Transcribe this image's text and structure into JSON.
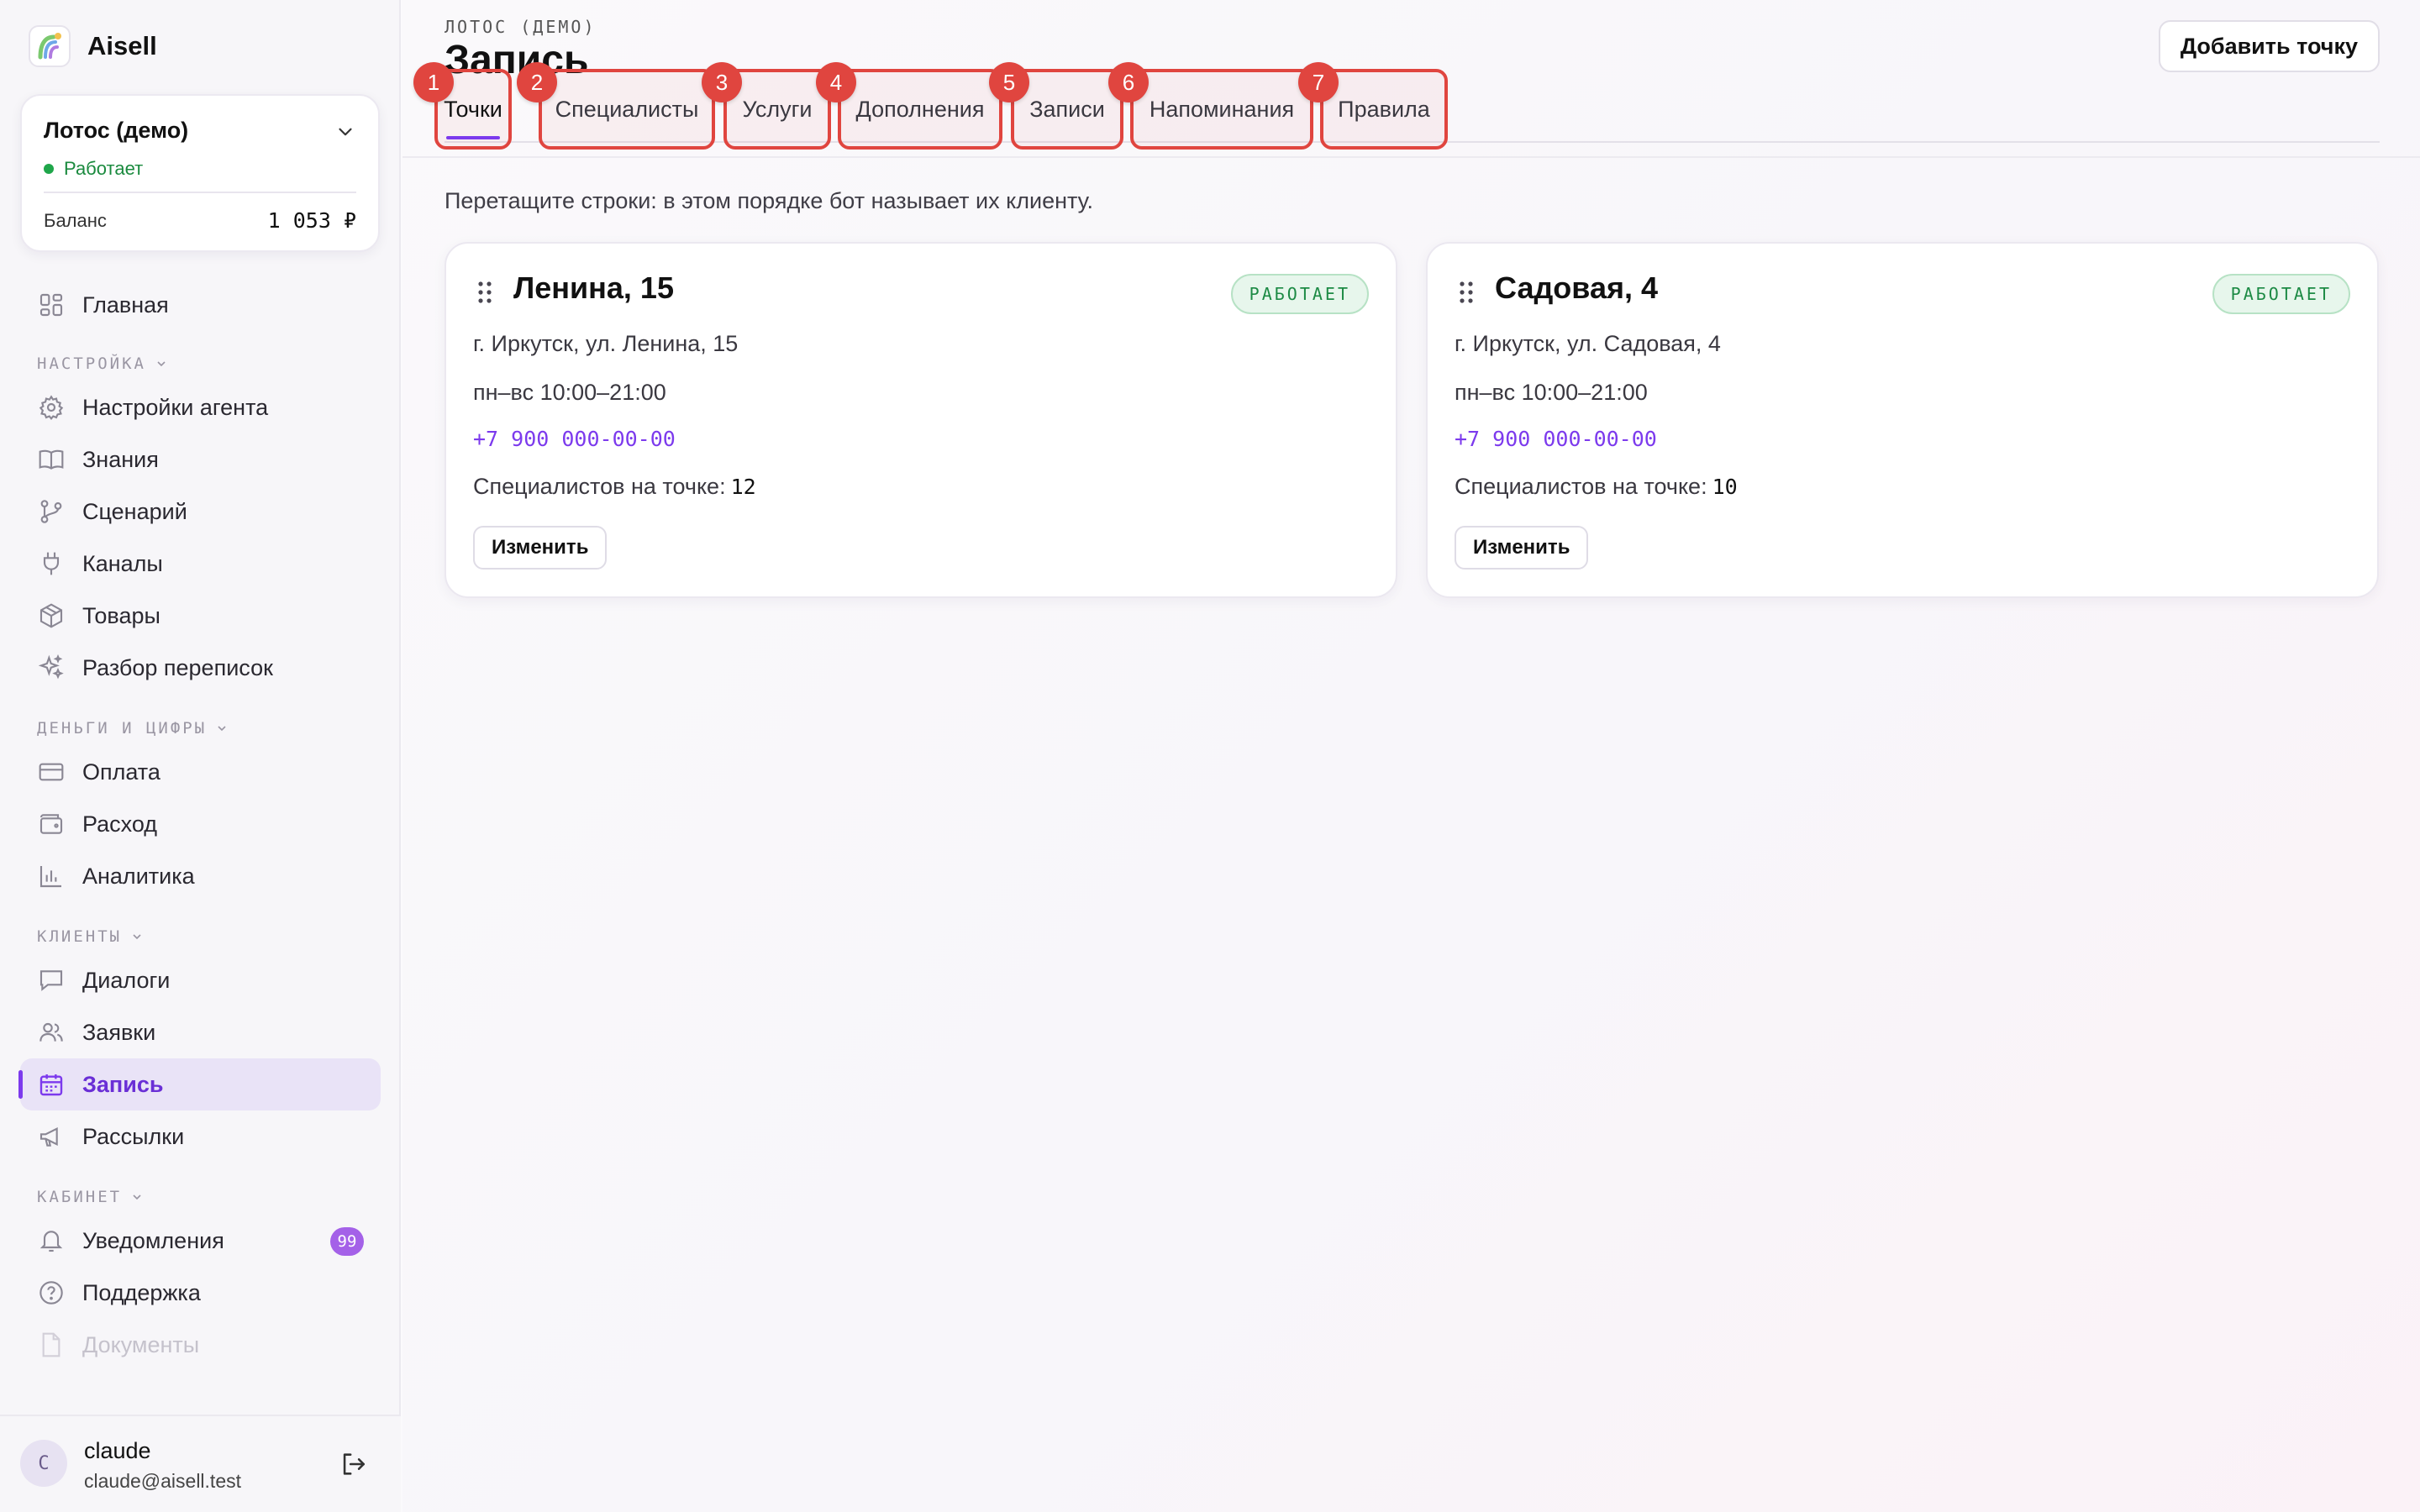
{
  "app": {
    "brand_name": "Aisell"
  },
  "workspace": {
    "name": "Лотос (демо)",
    "status": "Работает",
    "balance_label": "Баланс",
    "balance_value": "1 053 ₽"
  },
  "sidebar": {
    "home": {
      "label": "Главная",
      "icon": "dashboard-icon"
    },
    "sections": [
      {
        "title": "НАСТРОЙКА",
        "items": [
          {
            "label": "Настройки агента",
            "icon": "gear-icon"
          },
          {
            "label": "Знания",
            "icon": "book-icon"
          },
          {
            "label": "Сценарий",
            "icon": "branch-icon"
          },
          {
            "label": "Каналы",
            "icon": "plug-icon"
          },
          {
            "label": "Товары",
            "icon": "box-icon"
          },
          {
            "label": "Разбор переписок",
            "icon": "sparkle-icon"
          }
        ]
      },
      {
        "title": "ДЕНЬГИ И ЦИФРЫ",
        "items": [
          {
            "label": "Оплата",
            "icon": "credit-card-icon"
          },
          {
            "label": "Расход",
            "icon": "wallet-icon"
          },
          {
            "label": "Аналитика",
            "icon": "bar-chart-icon"
          }
        ]
      },
      {
        "title": "КЛИЕНТЫ",
        "items": [
          {
            "label": "Диалоги",
            "icon": "chat-icon"
          },
          {
            "label": "Заявки",
            "icon": "users-icon"
          },
          {
            "label": "Запись",
            "icon": "calendar-icon",
            "active": true
          },
          {
            "label": "Рассылки",
            "icon": "megaphone-icon"
          }
        ]
      },
      {
        "title": "КАБИНЕТ",
        "items": [
          {
            "label": "Уведомления",
            "icon": "bell-icon",
            "badge": "99"
          },
          {
            "label": "Поддержка",
            "icon": "help-circle-icon"
          },
          {
            "label": "Документы",
            "icon": "document-icon"
          }
        ]
      }
    ]
  },
  "user": {
    "initial": "C",
    "name": "claude",
    "email": "claude@aisell.test"
  },
  "header": {
    "eyebrow": "ЛОТОС (ДЕМО)",
    "title": "Запись",
    "add_button": "Добавить точку"
  },
  "tabs": [
    {
      "num": "1",
      "label": "Точки",
      "active": true
    },
    {
      "num": "2",
      "label": "Специалисты"
    },
    {
      "num": "3",
      "label": "Услуги"
    },
    {
      "num": "4",
      "label": "Дополнения"
    },
    {
      "num": "5",
      "label": "Записи"
    },
    {
      "num": "6",
      "label": "Напоминания"
    },
    {
      "num": "7",
      "label": "Правила"
    }
  ],
  "hint": "Перетащите строки: в этом порядке бот называет их клиенту.",
  "locations": [
    {
      "name": "Ленина, 15",
      "status": "РАБОТАЕТ",
      "address": "г. Иркутск, ул. Ленина, 15",
      "hours": "пн–вс 10:00–21:00",
      "phone": "+7 900 000-00-00",
      "specialists_label": "Специалистов на точке:",
      "specialists_count": "12",
      "edit_label": "Изменить"
    },
    {
      "name": "Садовая, 4",
      "status": "РАБОТАЕТ",
      "address": "г. Иркутск, ул. Садовая, 4",
      "hours": "пн–вс 10:00–21:00",
      "phone": "+7 900 000-00-00",
      "specialists_label": "Специалистов на точке:",
      "specialists_count": "10",
      "edit_label": "Изменить"
    }
  ]
}
